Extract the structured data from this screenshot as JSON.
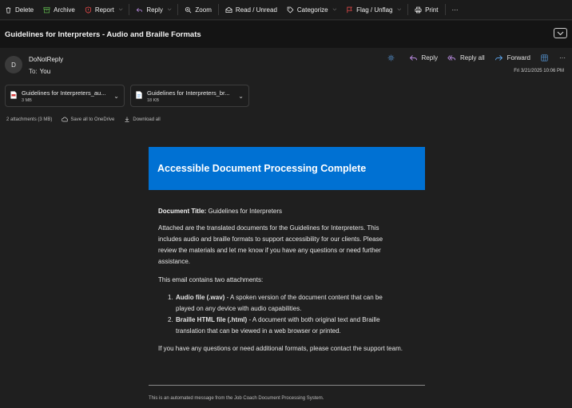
{
  "toolbar": {
    "delete": "Delete",
    "archive": "Archive",
    "report": "Report",
    "reply": "Reply",
    "zoom": "Zoom",
    "read_unread": "Read / Unread",
    "categorize": "Categorize",
    "flag": "Flag / Unflag",
    "print": "Print",
    "more": "···"
  },
  "subject": "Guidelines for Interpreters - Audio and Braille Formats",
  "message": {
    "avatar_initial": "D",
    "sender": "DoNotReply",
    "to_label": "To:",
    "to_value": "You",
    "date": "Fri 3/21/2025 10:06 PM",
    "actions": {
      "reply": "Reply",
      "reply_all": "Reply all",
      "forward": "Forward"
    }
  },
  "attachments": [
    {
      "name": "Guidelines for Interpreters_au...",
      "size": "3 MB",
      "icon": "pdf-file-icon"
    },
    {
      "name": "Guidelines for Interpreters_br...",
      "size": "18 KB",
      "icon": "document-file-icon"
    }
  ],
  "attachment_meta": {
    "summary": "2 attachments (3 MB)",
    "save_onedrive": "Save all to OneDrive",
    "download_all": "Download all"
  },
  "email_body": {
    "header_title": "Accessible Document Processing Complete",
    "doc_title_label": "Document Title:",
    "doc_title_value": "Guidelines for Interpreters",
    "para1": "Attached are the translated documents for the Guidelines for Interpreters. This includes audio and braille formats to support accessibility for our clients. Please review the materials and let me know if you have any questions or need further assistance.",
    "para2": "This email contains two attachments:",
    "list": [
      {
        "num": "1.",
        "label": "Audio file (.wav)",
        "text": "- A spoken version of the document content that can be played on any device with audio capabilities."
      },
      {
        "num": "2.",
        "label": "Braille HTML file (.html)",
        "text": "- A document with both original text and Braille translation that can be viewed in a web browser or printed."
      }
    ],
    "para3": "If you have any questions or need additional formats, please contact the support team.",
    "footer": "This is an automated message from the Job Coach Document Processing System."
  },
  "colors": {
    "accent": "#0071d3",
    "background": "#1f1f1f",
    "flag": "#e04848",
    "report": "#e04848",
    "archive": "#5aa94a"
  }
}
